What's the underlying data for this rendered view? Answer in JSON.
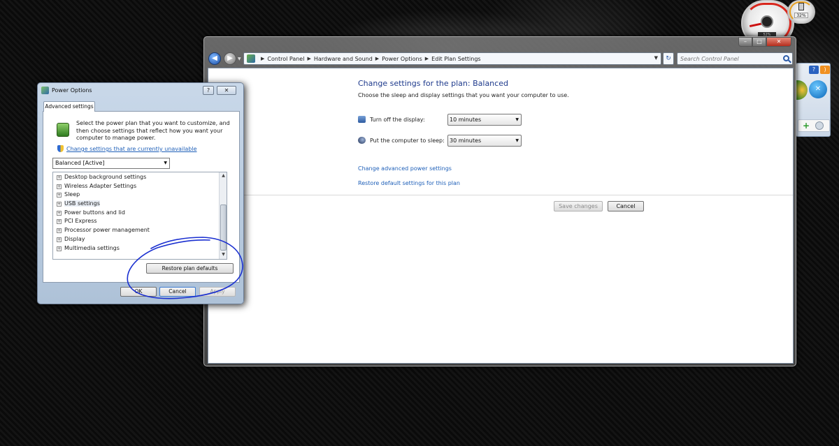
{
  "gadgets": {
    "battery_percent": "32%",
    "gauge_readout": "52%"
  },
  "control_panel": {
    "breadcrumbs": [
      "Control Panel",
      "Hardware and Sound",
      "Power Options",
      "Edit Plan Settings"
    ],
    "search_placeholder": "Search Control Panel",
    "title": "Change settings for the plan: Balanced",
    "subtitle": "Choose the sleep and display settings that you want your computer to use.",
    "display_label": "Turn off the display:",
    "display_value": "10 minutes",
    "sleep_label": "Put the computer to sleep:",
    "sleep_value": "30 minutes",
    "advanced_link": "Change advanced power settings",
    "restore_link": "Restore default settings for this plan",
    "save_label": "Save changes",
    "cancel_label": "Cancel"
  },
  "power_options": {
    "title": "Power Options",
    "help_label": "?",
    "close_label": "✕",
    "tab_label": "Advanced settings",
    "description": "Select the power plan that you want to customize, and then choose settings that reflect how you want your computer to manage power.",
    "change_link": "Change settings that are currently unavailable",
    "plan_value": "Balanced [Active]",
    "tree_items": [
      "Desktop background settings",
      "Wireless Adapter Settings",
      "Sleep",
      "USB settings",
      "Power buttons and lid",
      "PCI Express",
      "Processor power management",
      "Display",
      "Multimedia settings"
    ],
    "restore_label": "Restore plan defaults",
    "ok_label": "OK",
    "cancel_label": "Cancel",
    "apply_label": "Apply"
  },
  "colors": {
    "link": "#1e5fb8",
    "title": "#1e3a8c",
    "annotation": "#1a2fd0"
  }
}
